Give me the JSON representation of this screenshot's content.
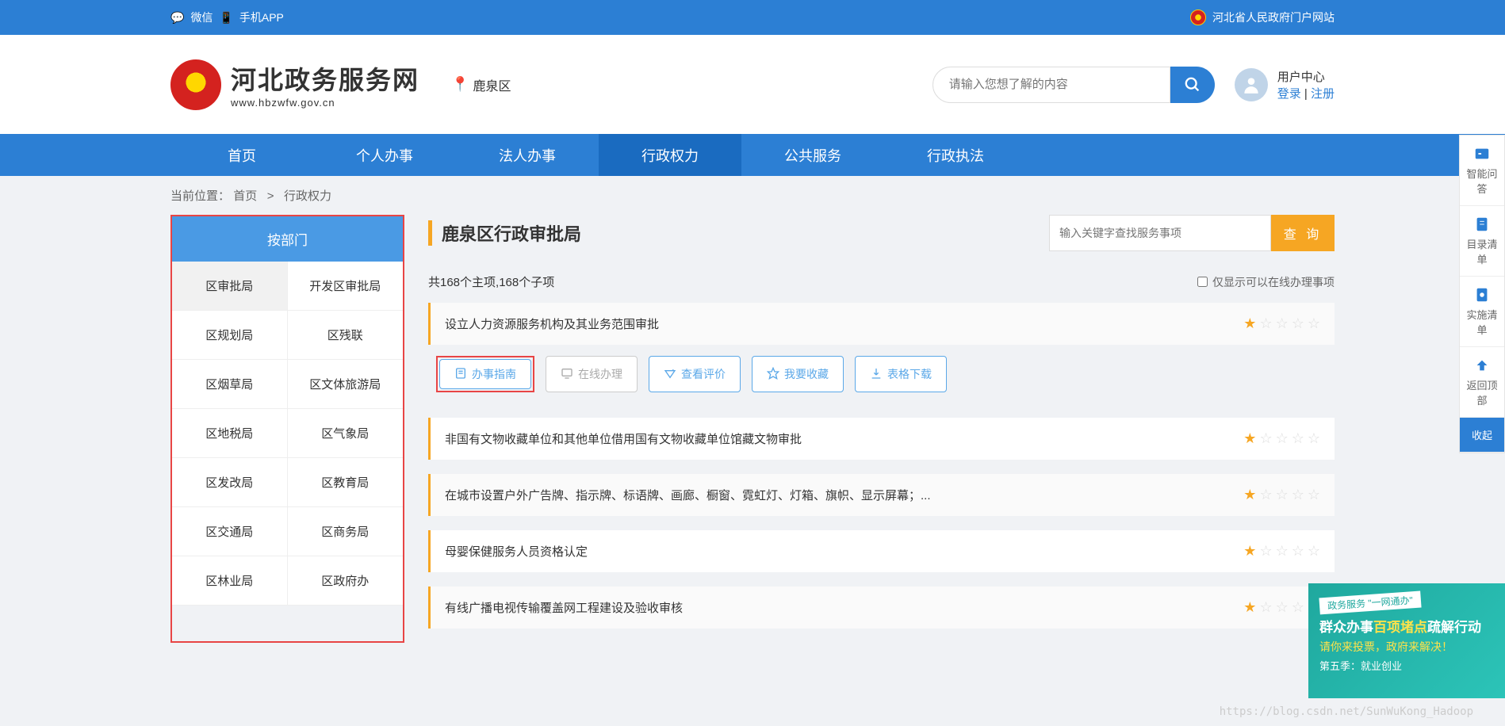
{
  "topbar": {
    "wechat": "微信",
    "app": "手机APP",
    "gov_portal": "河北省人民政府门户网站"
  },
  "header": {
    "title": "河北政务服务网",
    "url": "www.hbzwfw.gov.cn",
    "location": "鹿泉区",
    "search_placeholder": "请输入您想了解的内容",
    "user_center": "用户中心",
    "login": "登录",
    "register": "注册"
  },
  "nav": {
    "items": [
      "首页",
      "个人办事",
      "法人办事",
      "行政权力",
      "公共服务",
      "行政执法"
    ],
    "active_index": 3
  },
  "breadcrumb": {
    "label": "当前位置：",
    "home": "首页",
    "sep": ">",
    "current": "行政权力"
  },
  "sidebar": {
    "header": "按部门",
    "depts": [
      "区审批局",
      "开发区审批局",
      "区规划局",
      "区残联",
      "区烟草局",
      "区文体旅游局",
      "区地税局",
      "区气象局",
      "区发改局",
      "区教育局",
      "区交通局",
      "区商务局",
      "区林业局",
      "区政府办"
    ],
    "active_index": 0
  },
  "content": {
    "title": "鹿泉区行政审批局",
    "filter_placeholder": "输入关键字查找服务事项",
    "query_btn": "查 询",
    "count_text": "共168个主项,168个子项",
    "online_only": "仅显示可以在线办理事项",
    "actions": {
      "guide": "办事指南",
      "online": "在线办理",
      "review": "查看评价",
      "favorite": "我要收藏",
      "download": "表格下载"
    },
    "items": [
      {
        "title": "设立人力资源服务机构及其业务范围审批",
        "stars": 1,
        "expanded": true
      },
      {
        "title": "非国有文物收藏单位和其他单位借用国有文物收藏单位馆藏文物审批",
        "stars": 1
      },
      {
        "title": "在城市设置户外广告牌、指示牌、标语牌、画廊、橱窗、霓虹灯、灯箱、旗帜、显示屏幕；...",
        "stars": 1
      },
      {
        "title": "母婴保健服务人员资格认定",
        "stars": 1
      },
      {
        "title": "有线广播电视传输覆盖网工程建设及验收审核",
        "stars": 1
      }
    ]
  },
  "rail": {
    "items": [
      "智能问答",
      "目录清单",
      "实施清单",
      "返回顶部",
      "收起"
    ]
  },
  "promo": {
    "banner": "政务服务 \"一网通办\"",
    "line1_a": "群众办事",
    "line1_b": "百项堵点",
    "line1_c": "疏解行动",
    "line2": "请你来投票，政府来解决！",
    "line3_a": "第",
    "line3_b": "五",
    "line3_c": "季：就业创业"
  },
  "watermark": "https://blog.csdn.net/SunWuKong_Hadoop"
}
